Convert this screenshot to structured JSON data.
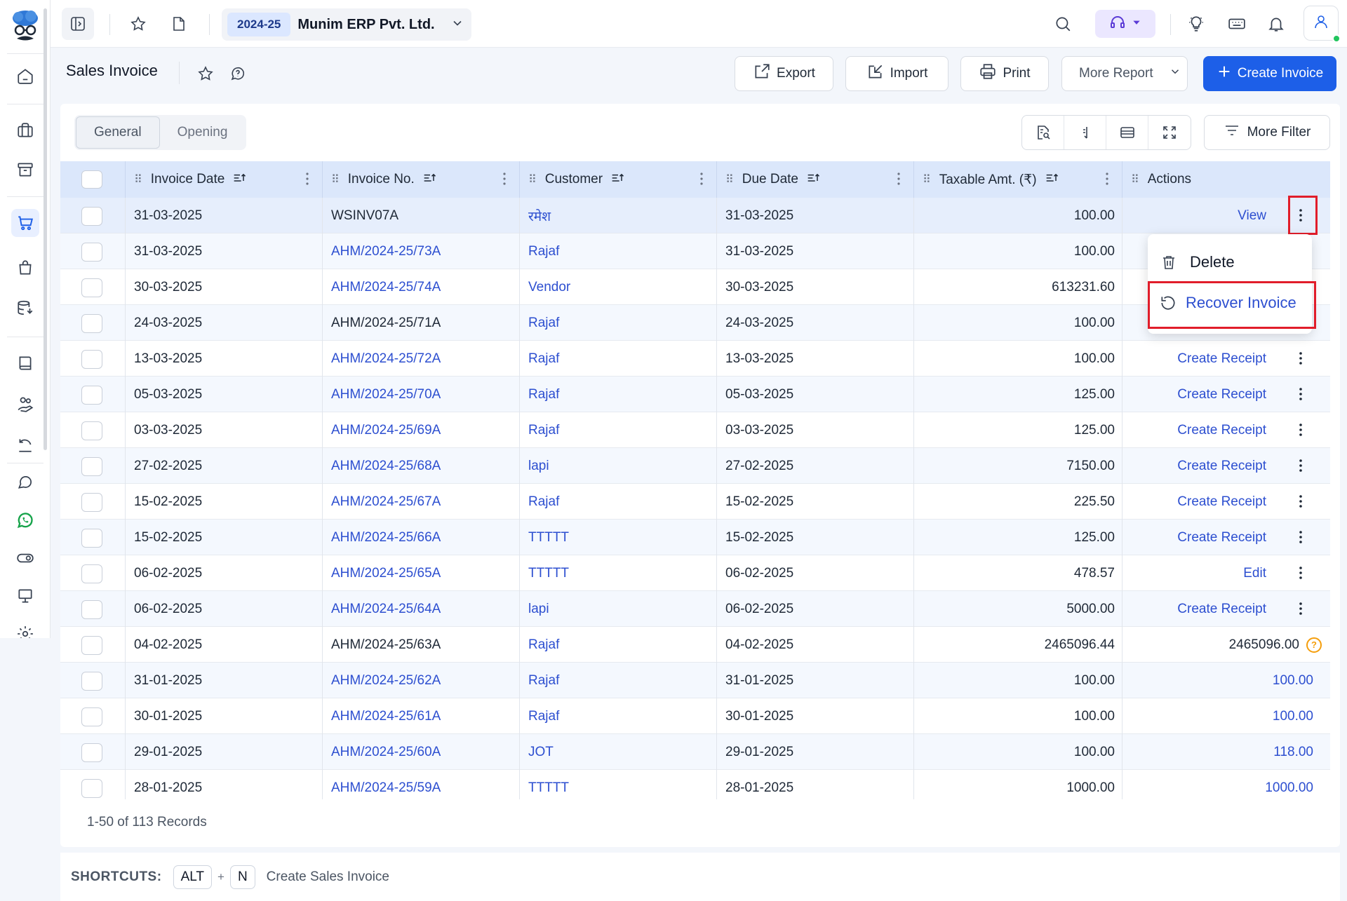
{
  "topbar": {
    "financial_year": "2024-25",
    "company_name": "Munim ERP Pvt. Ltd."
  },
  "page": {
    "title": "Sales Invoice",
    "buttons": {
      "export": "Export",
      "import": "Import",
      "print": "Print",
      "more_report": "More Report",
      "create_invoice": "Create Invoice"
    }
  },
  "tabs": [
    "General",
    "Opening"
  ],
  "more_filter": "More Filter",
  "table": {
    "headers": [
      "Invoice Date",
      "Invoice No.",
      "Customer",
      "Due Date",
      "Taxable Amt. (₹)",
      "Actions"
    ],
    "rows": [
      {
        "date": "31-03-2025",
        "invoice_no": "WSINV07A",
        "customer": "रमेश",
        "due": "31-03-2025",
        "taxable": "100.00",
        "action": "View"
      },
      {
        "date": "31-03-2025",
        "invoice_no": "AHM/2024-25/73A",
        "customer": "Rajaf",
        "due": "31-03-2025",
        "taxable": "100.00",
        "action": ""
      },
      {
        "date": "30-03-2025",
        "invoice_no": "AHM/2024-25/74A",
        "customer": "Vendor",
        "due": "30-03-2025",
        "taxable": "613231.60",
        "action": ""
      },
      {
        "date": "24-03-2025",
        "invoice_no": "AHM/2024-25/71A",
        "customer": "Rajaf",
        "due": "24-03-2025",
        "taxable": "100.00",
        "action": ""
      },
      {
        "date": "13-03-2025",
        "invoice_no": "AHM/2024-25/72A",
        "customer": "Rajaf",
        "due": "13-03-2025",
        "taxable": "100.00",
        "action": "Create Receipt"
      },
      {
        "date": "05-03-2025",
        "invoice_no": "AHM/2024-25/70A",
        "customer": "Rajaf",
        "due": "05-03-2025",
        "taxable": "125.00",
        "action": "Create Receipt"
      },
      {
        "date": "03-03-2025",
        "invoice_no": "AHM/2024-25/69A",
        "customer": "Rajaf",
        "due": "03-03-2025",
        "taxable": "125.00",
        "action": "Create Receipt"
      },
      {
        "date": "27-02-2025",
        "invoice_no": "AHM/2024-25/68A",
        "customer": "lapi",
        "due": "27-02-2025",
        "taxable": "7150.00",
        "action": "Create Receipt"
      },
      {
        "date": "15-02-2025",
        "invoice_no": "AHM/2024-25/67A",
        "customer": "Rajaf",
        "due": "15-02-2025",
        "taxable": "225.50",
        "action": "Create Receipt"
      },
      {
        "date": "15-02-2025",
        "invoice_no": "AHM/2024-25/66A",
        "customer": "TTTTT",
        "due": "15-02-2025",
        "taxable": "125.00",
        "action": "Create Receipt"
      },
      {
        "date": "06-02-2025",
        "invoice_no": "AHM/2024-25/65A",
        "customer": "TTTTT",
        "due": "06-02-2025",
        "taxable": "478.57",
        "action": "Edit"
      },
      {
        "date": "06-02-2025",
        "invoice_no": "AHM/2024-25/64A",
        "customer": "lapi",
        "due": "06-02-2025",
        "taxable": "5000.00",
        "action": "Create Receipt"
      },
      {
        "date": "04-02-2025",
        "invoice_no": "AHM/2024-25/63A",
        "customer": "Rajaf",
        "due": "04-02-2025",
        "taxable": "2465096.44",
        "amount": "2465096.00"
      },
      {
        "date": "31-01-2025",
        "invoice_no": "AHM/2024-25/62A",
        "customer": "Rajaf",
        "due": "31-01-2025",
        "taxable": "100.00",
        "amount": "100.00"
      },
      {
        "date": "30-01-2025",
        "invoice_no": "AHM/2024-25/61A",
        "customer": "Rajaf",
        "due": "30-01-2025",
        "taxable": "100.00",
        "amount": "100.00"
      },
      {
        "date": "29-01-2025",
        "invoice_no": "AHM/2024-25/60A",
        "customer": "JOT",
        "due": "29-01-2025",
        "taxable": "100.00",
        "amount": "118.00"
      },
      {
        "date": "28-01-2025",
        "invoice_no": "AHM/2024-25/59A",
        "customer": "TTTTT",
        "due": "28-01-2025",
        "taxable": "1000.00",
        "amount": "1000.00"
      }
    ]
  },
  "dropdown": {
    "delete": "Delete",
    "recover": "Recover Invoice"
  },
  "records": "1-50 of 113 Records",
  "shortcuts": {
    "label": "SHORTCUTS:",
    "key1": "ALT",
    "plus": "+",
    "key2": "N",
    "description": "Create Sales Invoice"
  },
  "colors": {
    "primary": "#1d5fe8",
    "link": "#2d4fd0",
    "header_bg": "#dbe7fb",
    "highlight": "#e11d2a"
  }
}
